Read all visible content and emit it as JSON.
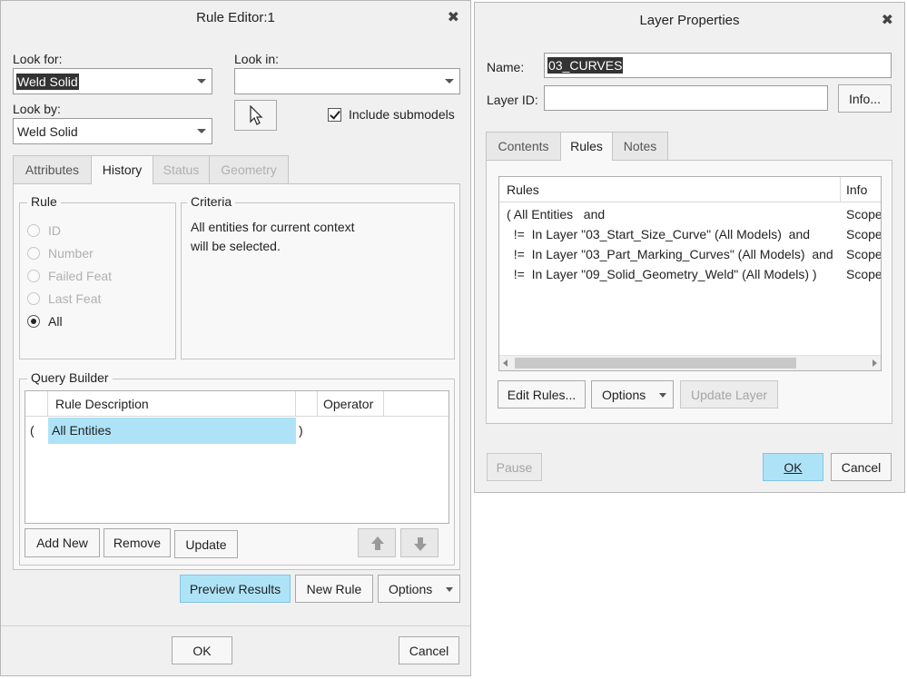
{
  "rule_editor": {
    "title": "Rule Editor:1",
    "look_for_label": "Look for:",
    "look_for_value": "Weld Solid",
    "look_in_label": "Look in:",
    "look_in_value": "",
    "look_by_label": "Look by:",
    "look_by_value": "Weld Solid",
    "include_submodels_label": "Include submodels",
    "include_submodels_checked": true,
    "tabs": [
      {
        "label": "Attributes",
        "state": "normal"
      },
      {
        "label": "History",
        "state": "active"
      },
      {
        "label": "Status",
        "state": "disabled"
      },
      {
        "label": "Geometry",
        "state": "disabled"
      }
    ],
    "rule_group": {
      "title": "Rule",
      "options": [
        {
          "label": "ID",
          "checked": false
        },
        {
          "label": "Number",
          "checked": false
        },
        {
          "label": "Failed Feat",
          "checked": false
        },
        {
          "label": "Last Feat",
          "checked": false
        },
        {
          "label": "All",
          "checked": true
        }
      ]
    },
    "criteria_group": {
      "title": "Criteria",
      "text_line1": "All entities for current context",
      "text_line2": "will be selected."
    },
    "query_builder": {
      "title": "Query Builder",
      "columns": [
        "Rule Description",
        "Operator"
      ],
      "rows": [
        {
          "open_paren": "(",
          "description": "All Entities",
          "close_paren": ")",
          "operator": ""
        }
      ],
      "buttons": {
        "add_new": "Add New",
        "remove": "Remove",
        "update": "Update"
      }
    },
    "buttons": {
      "preview_results": "Preview Results",
      "new_rule": "New Rule",
      "options": "Options",
      "ok": "OK",
      "cancel": "Cancel"
    }
  },
  "layer_properties": {
    "title": "Layer Properties",
    "name_label": "Name:",
    "name_value": "03_CURVES",
    "layer_id_label": "Layer ID:",
    "layer_id_value": "",
    "info_button": "Info...",
    "tabs": [
      {
        "label": "Contents",
        "state": "normal"
      },
      {
        "label": "Rules",
        "state": "active"
      },
      {
        "label": "Notes",
        "state": "normal"
      }
    ],
    "rules_table": {
      "columns": [
        "Rules",
        "Info"
      ],
      "rows": [
        {
          "rule": "( All Entities   and",
          "info": "Scope"
        },
        {
          "rule": "  !=  In Layer \"03_Start_Size_Curve\" (All Models)  and",
          "info": "Scope"
        },
        {
          "rule": "  !=  In Layer \"03_Part_Marking_Curves\" (All Models)  and",
          "info": "Scope"
        },
        {
          "rule": "  !=  In Layer \"09_Solid_Geometry_Weld\" (All Models) )",
          "info": "Scope"
        }
      ]
    },
    "buttons": {
      "edit_rules": "Edit Rules...",
      "options": "Options",
      "update_layer": "Update Layer",
      "pause": "Pause",
      "ok": "OK",
      "cancel": "Cancel"
    }
  }
}
